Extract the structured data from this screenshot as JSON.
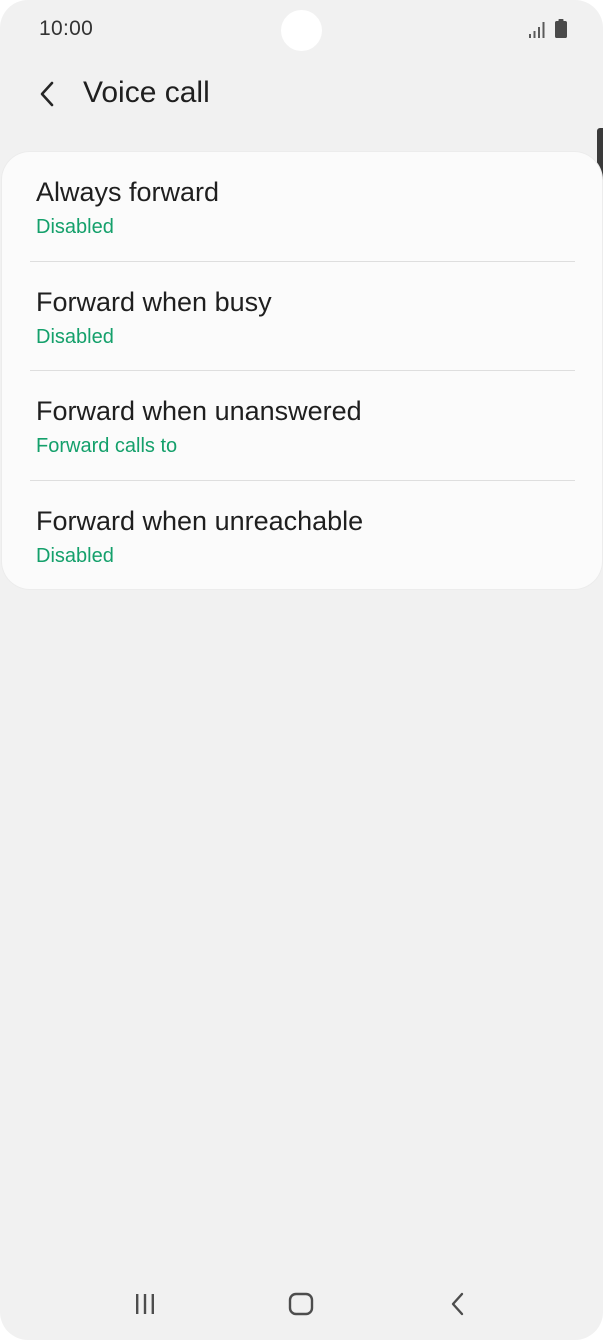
{
  "status_bar": {
    "time": "10:00"
  },
  "header": {
    "back_icon": "chevron-left-icon",
    "title": "Voice call"
  },
  "list": {
    "items": [
      {
        "title": "Always forward",
        "subtitle": "Disabled"
      },
      {
        "title": "Forward when busy",
        "subtitle": "Disabled"
      },
      {
        "title": "Forward when unanswered",
        "subtitle": "Forward calls to"
      },
      {
        "title": "Forward when unreachable",
        "subtitle": "Disabled"
      }
    ]
  },
  "colors": {
    "accent": "#14a06b",
    "background": "#f1f1f1",
    "card": "#fbfbfb",
    "text": "#1f1f1f"
  },
  "nav_bar": {
    "recents_icon": "recents-icon",
    "home_icon": "home-icon",
    "back_icon": "back-icon"
  }
}
